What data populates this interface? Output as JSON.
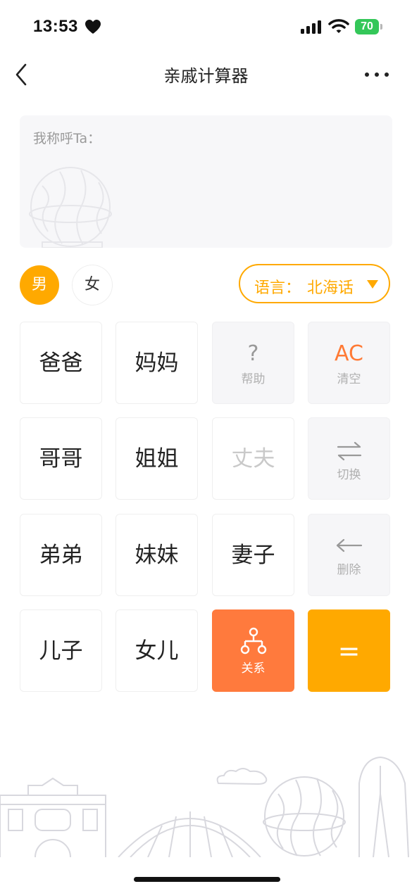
{
  "status_bar": {
    "time": "13:53",
    "battery": "70"
  },
  "nav": {
    "title": "亲戚计算器"
  },
  "display": {
    "prompt": "我称呼Ta："
  },
  "gender": {
    "male": "男",
    "female": "女",
    "selected": "男"
  },
  "language": {
    "label": "语言：",
    "value": "北海话"
  },
  "keys": {
    "dad": "爸爸",
    "mom": "妈妈",
    "help_symbol": "?",
    "help": "帮助",
    "ac_symbol": "AC",
    "clear": "清空",
    "elder_brother": "哥哥",
    "elder_sister": "姐姐",
    "husband": "丈夫",
    "switch": "切换",
    "younger_brother": "弟弟",
    "younger_sister": "妹妹",
    "wife": "妻子",
    "delete": "删除",
    "son": "儿子",
    "daughter": "女儿",
    "relation": "关系",
    "equals": "="
  },
  "colors": {
    "accent": "#ffa900",
    "orange": "#ff7a3d",
    "battery": "#34c759"
  },
  "icons": [
    "back-icon",
    "more-icon",
    "heart-icon",
    "signal-icon",
    "wifi-icon",
    "battery-icon",
    "caret-down-icon",
    "swap-icon",
    "back-arrow-icon",
    "relation-tree-icon"
  ]
}
